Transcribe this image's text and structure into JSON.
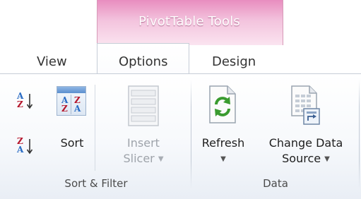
{
  "contextual_group": {
    "title": "PivotTable Tools"
  },
  "tabs": [
    {
      "label": "View"
    },
    {
      "label": "Options"
    },
    {
      "label": "Design"
    }
  ],
  "groups": {
    "sort_filter": {
      "label": "Sort & Filter",
      "sort_button": {
        "label": "Sort"
      },
      "insert_slicer": {
        "line1": "Insert",
        "line2": "Slicer"
      }
    },
    "data": {
      "label": "Data",
      "refresh": {
        "label": "Refresh"
      },
      "change_data_source": {
        "line1": "Change Data",
        "line2": "Source"
      }
    }
  },
  "icons": {
    "sort_az": {
      "top": "A",
      "bottom": "Z"
    },
    "sort_za": {
      "top": "Z",
      "bottom": "A"
    }
  },
  "colors": {
    "contextual_tab": "#e88dbf",
    "sort_letter_a": "#2a6cc4",
    "sort_letter_z": "#b5162c",
    "refresh_green": "#3a9b2f"
  }
}
